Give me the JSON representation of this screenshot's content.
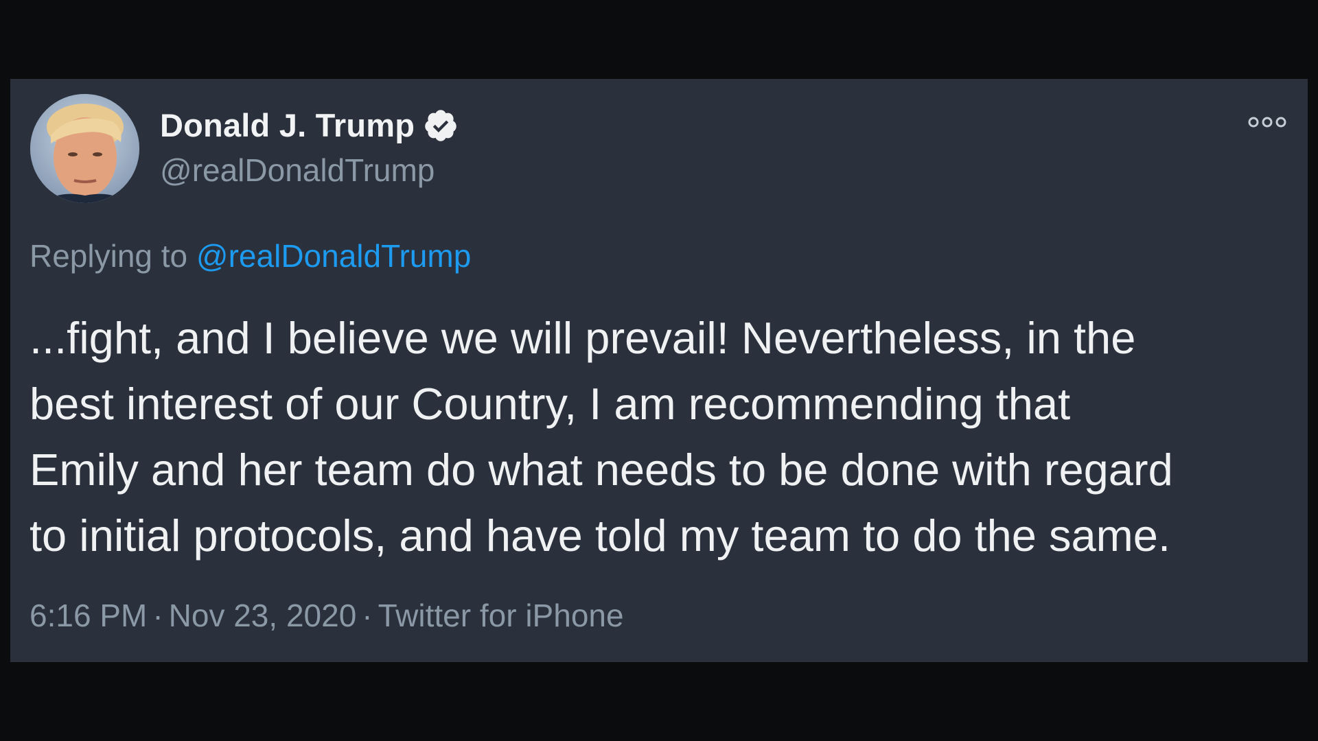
{
  "tweet": {
    "author": {
      "display_name": "Donald J. Trump",
      "handle": "@realDonaldTrump",
      "verified": true
    },
    "reply": {
      "prefix": "Replying to",
      "handle": "@realDonaldTrump"
    },
    "body_lines": [
      "...fight, and I believe we will prevail! Nevertheless, in the",
      "best interest of our Country, I am recommending that",
      "Emily and her team do what needs to be done with regard",
      "to initial protocols, and have told my team to do the same."
    ],
    "meta": {
      "time": "6:16 PM",
      "date": "Nov 23, 2020",
      "source": "Twitter for iPhone",
      "separator": "·"
    }
  },
  "icons": {
    "verified": "verified-badge-icon",
    "more": "more-options-icon",
    "avatar": "profile-photo"
  },
  "colors": {
    "card_background": "#2a313c",
    "page_background": "#0b0c0d",
    "primary_text": "#f0f1f3",
    "secondary_text": "#8b98a5",
    "link": "#1d9bf0"
  }
}
